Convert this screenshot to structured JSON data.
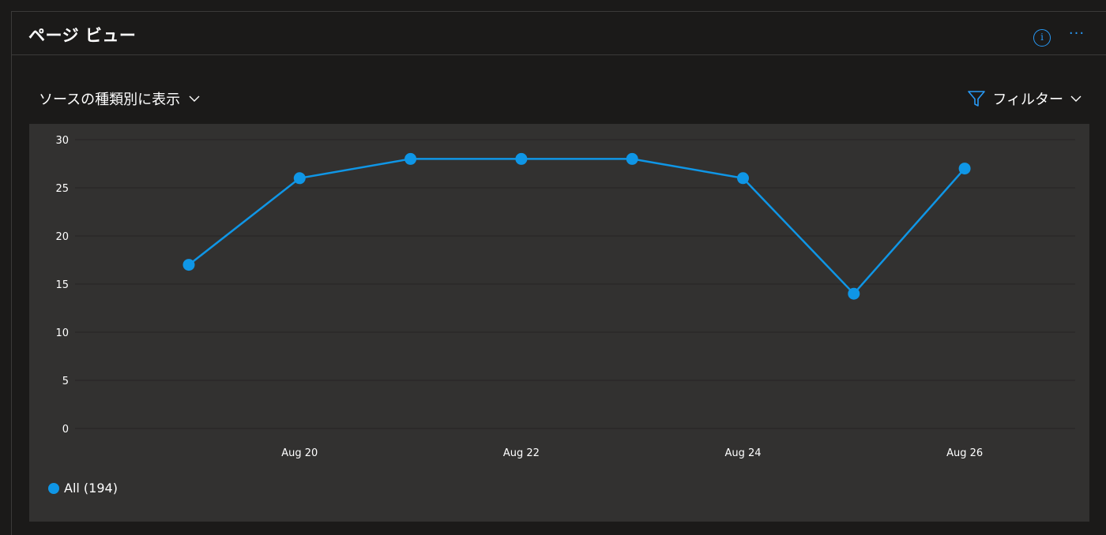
{
  "card": {
    "title": "ページ ビュー",
    "info_glyph": "i",
    "more_glyph": "···"
  },
  "controls": {
    "view_by_label": "ソースの種類別に表示",
    "filter_label": "フィルター"
  },
  "colors": {
    "series": "#0f96e6",
    "grid": "#252423",
    "accent": "#2899f5"
  },
  "chart_data": {
    "type": "line",
    "ylim": [
      0,
      30
    ],
    "yticks": [
      "0",
      "5",
      "10",
      "15",
      "20",
      "25",
      "30"
    ],
    "x_tick_labels": [
      "Aug 20",
      "Aug 22",
      "Aug 24",
      "Aug 26"
    ],
    "x": [
      "Aug 19",
      "Aug 20",
      "Aug 21",
      "Aug 22",
      "Aug 23",
      "Aug 24",
      "Aug 25",
      "Aug 26"
    ],
    "series": [
      {
        "name": "All (194)",
        "values": [
          17,
          26,
          28,
          28,
          28,
          26,
          14,
          27
        ]
      }
    ]
  }
}
